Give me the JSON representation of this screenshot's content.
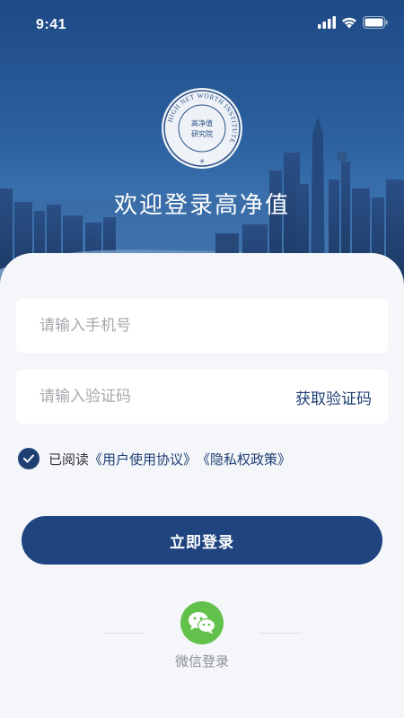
{
  "status_bar": {
    "time": "9:41",
    "icons": [
      "signal-icon",
      "wifi-icon",
      "battery-icon"
    ]
  },
  "hero": {
    "seal_icon": "institute-seal-icon",
    "seal_text": "HIGH NET WORTH INSTITUTE",
    "seal_center": "高净值研究院",
    "welcome": "欢迎登录高净值"
  },
  "form": {
    "phone_placeholder": "请输入手机号",
    "code_placeholder": "请输入验证码",
    "get_code": "获取验证码"
  },
  "agreement": {
    "checked": true,
    "prefix": "已阅读",
    "user_agreement": "《用户使用协议》",
    "privacy_policy": "《隐私权政策》"
  },
  "login_button": "立即登录",
  "wechat": {
    "icon": "wechat-icon",
    "label": "微信登录"
  },
  "colors": {
    "primary": "#1f4480",
    "hero_top": "#1e4a86",
    "wechat_green": "#62c14a",
    "background": "#f4f6fa"
  }
}
